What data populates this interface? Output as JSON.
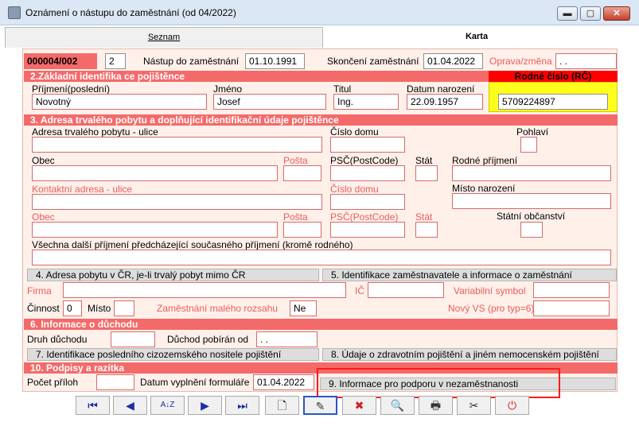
{
  "window": {
    "title": "Oznámení o nástupu do zaměstnání (od 04/2022)",
    "controls": {
      "minimize": "▬",
      "maximize": "▢",
      "close": "✕"
    }
  },
  "tabs": [
    {
      "label": "Seznam"
    },
    {
      "label": "Karta"
    }
  ],
  "header": {
    "record_id": "000004/002",
    "record_seq": "2",
    "start_label": "Nástup do zaměstnání",
    "start_value": "01.10.1991",
    "end_label": "Skončení zaměstnání",
    "end_value": "01.04.2022",
    "change_label": "Oprava/změna",
    "change_value": ". ."
  },
  "section2": {
    "title": "2.Základní identifika ce pojištěnce",
    "surname_label": "Příjmení(poslední)",
    "surname_value": "Novotný",
    "firstname_label": "Jméno",
    "firstname_value": "Josef",
    "title_label": "Titul",
    "title_value": "Ing.",
    "birth_label": "Datum narození",
    "birth_value": "22.09.1957",
    "rc_label": "Rodné číslo (RČ)",
    "rc_value": "5709224897"
  },
  "section3": {
    "title": "3. Adresa trvalého pobytu a doplňující identifikační údaje pojištěnce",
    "street_label": "Adresa trvalého pobytu - ulice",
    "house_label": "Číslo domu",
    "gender_label": "Pohlaví",
    "city_label": "Obec",
    "post_label": "Pošta",
    "zip_label": "PSČ(PostCode)",
    "state_label": "Stát",
    "birthname_label": "Rodné příjmení",
    "contact_street_label": "Kontaktní adresa - ulice",
    "contact_house_label": "Číslo domu",
    "birthplace_label": "Místo narození",
    "contact_city_label": "Obec",
    "contact_post_label": "Pošta",
    "contact_zip_label": "PSČ(PostCode)",
    "contact_state_label": "Stát",
    "citizenship_label": "Státní občanství",
    "other_surnames_label": "Všechna další příjmení předcházející současného příjmení (kromě rodného)"
  },
  "subsections": {
    "s4": "4. Adresa pobytu v ČR, je-li trvalý pobyt mimo ČR",
    "s5": "5. Identifikace zaměstnavatele a informace o zaměstnání",
    "s7": "7. Identifikace posledního cizozemského nositele pojištění",
    "s8": "8. Údaje o zdravotním pojištění a jiném nemocenském pojištění",
    "s9": "9. Informace pro podporu v nezaměstnanosti"
  },
  "employer": {
    "firm_label": "Firma",
    "ic_label": "IČ",
    "varsym_label": "Variabilní symbol",
    "activity_label": "Činnost",
    "activity_value": "0",
    "place_label": "Místo",
    "small_job_label": "Zaměstnání malého rozsahu",
    "small_job_value": "Ne",
    "new_vs_label": "Nový VS (pro typ=6)"
  },
  "section6": {
    "title": "6. Informace o důchodu",
    "pension_type_label": "Druh důchodu",
    "pension_since_label": "Důchod pobírán od",
    "pension_since_value": ". ."
  },
  "section10": {
    "title": "10. Podpisy a razítka",
    "attachments_label": "Počet příloh",
    "filled_date_label": "Datum vyplnění formuláře",
    "filled_date_value": "01.04.2022"
  },
  "toolbar": [
    {
      "name": "first-record-button",
      "glyph": "⏮"
    },
    {
      "name": "previous-record-button",
      "glyph": "◀"
    },
    {
      "name": "sort-button",
      "glyph": "A↓Z"
    },
    {
      "name": "next-record-button",
      "glyph": "▶"
    },
    {
      "name": "last-record-button",
      "glyph": "⏭"
    },
    {
      "name": "new-record-button",
      "glyph": "🗋"
    },
    {
      "name": "edit-record-button",
      "glyph": "✎"
    },
    {
      "name": "delete-record-button",
      "glyph": "✖"
    },
    {
      "name": "search-button",
      "glyph": "🔍"
    },
    {
      "name": "print-button",
      "glyph": "🖶"
    },
    {
      "name": "tools-button",
      "glyph": "✂"
    },
    {
      "name": "exit-button",
      "glyph": "⏻"
    }
  ],
  "colors": {
    "section_header": "#f46a6a",
    "form_bg": "#fff0ea",
    "rc_header": "#ff0000",
    "rc_box": "#ffff1e",
    "highlight_frame": "#ff1a1a"
  }
}
